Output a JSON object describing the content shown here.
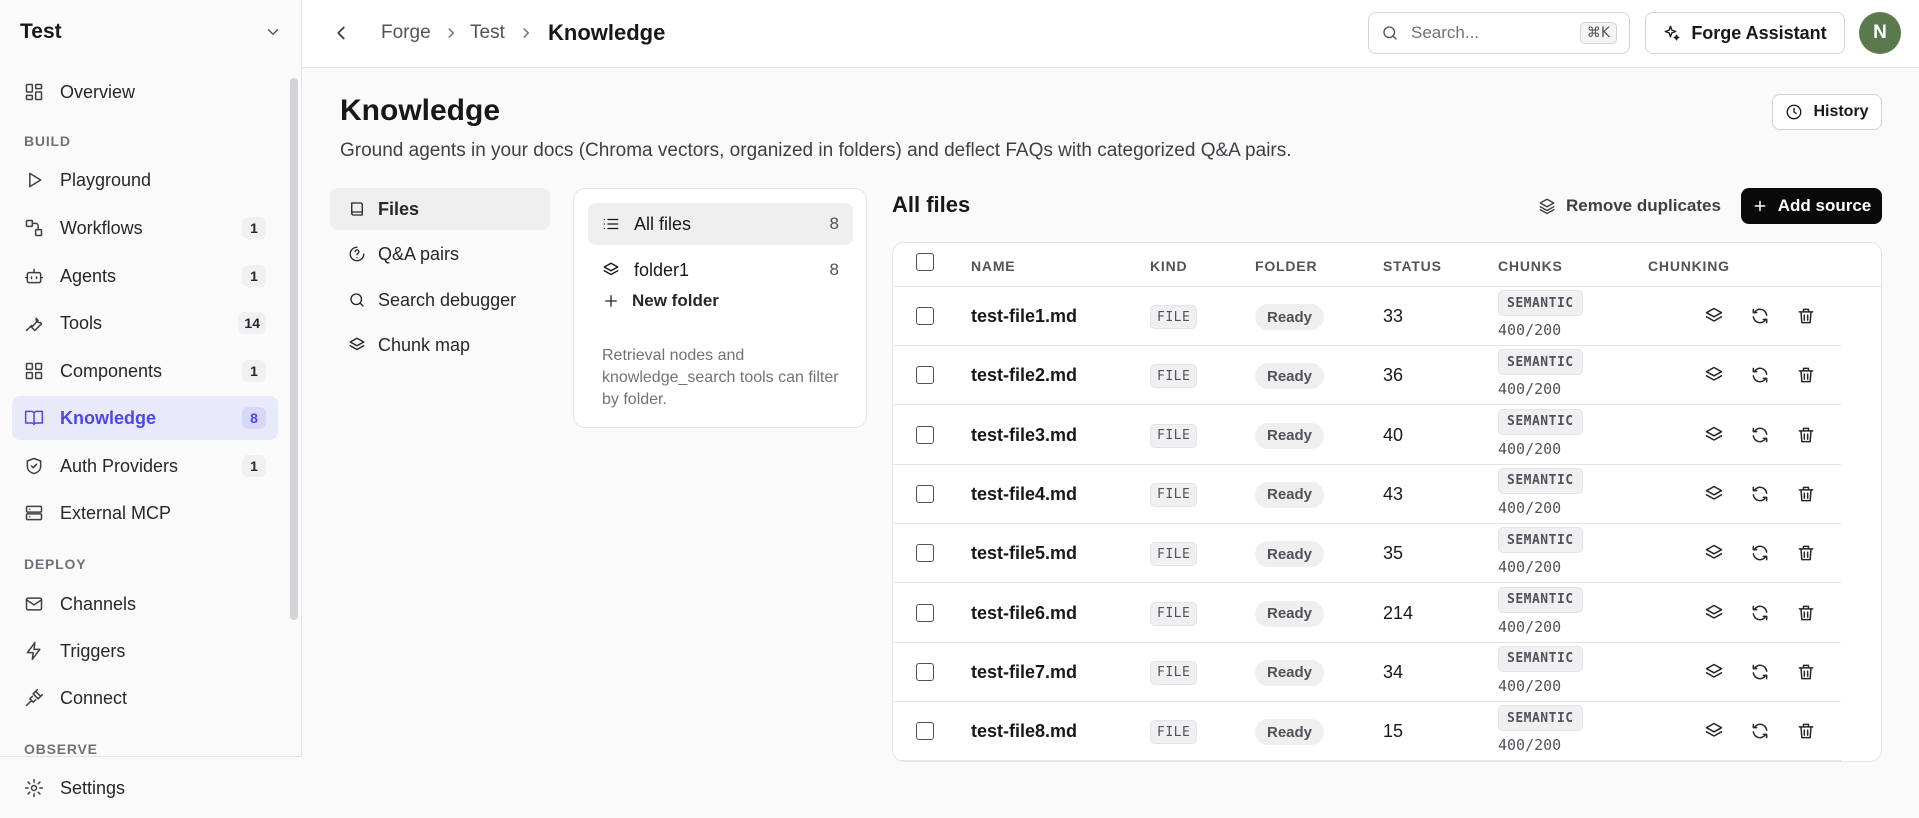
{
  "workspace": {
    "name": "Test"
  },
  "sidebar": {
    "items": [
      {
        "label": "Overview",
        "count": ""
      },
      {
        "label": "Playground",
        "count": ""
      },
      {
        "label": "Workflows",
        "count": "1"
      },
      {
        "label": "Agents",
        "count": "1"
      },
      {
        "label": "Tools",
        "count": "14"
      },
      {
        "label": "Components",
        "count": "1"
      },
      {
        "label": "Knowledge",
        "count": "8"
      },
      {
        "label": "Auth Providers",
        "count": "1"
      },
      {
        "label": "External MCP",
        "count": ""
      },
      {
        "label": "Channels",
        "count": ""
      },
      {
        "label": "Triggers",
        "count": ""
      },
      {
        "label": "Connect",
        "count": ""
      }
    ],
    "sections": {
      "build": "BUILD",
      "deploy": "DEPLOY",
      "observe": "OBSERVE"
    },
    "settings_label": "Settings"
  },
  "header": {
    "breadcrumb": [
      "Forge",
      "Test",
      "Knowledge"
    ],
    "search_placeholder": "Search...",
    "search_shortcut": "⌘K",
    "assistant_label": "Forge Assistant",
    "avatar_initial": "N"
  },
  "page": {
    "title": "Knowledge",
    "subtitle": "Ground agents in your docs (Chroma vectors, organized in folders) and deflect FAQs with categorized Q&A pairs.",
    "history_label": "History"
  },
  "subnav": [
    "Files",
    "Q&A pairs",
    "Search debugger",
    "Chunk map"
  ],
  "folders": {
    "items": [
      {
        "label": "All files",
        "count": "8"
      },
      {
        "label": "folder1",
        "count": "8"
      }
    ],
    "new_folder_label": "New folder",
    "note": "Retrieval nodes and knowledge_search tools can filter by folder."
  },
  "files": {
    "title": "All files",
    "remove_duplicates_label": "Remove duplicates",
    "add_source_label": "Add source",
    "columns": [
      "NAME",
      "KIND",
      "FOLDER",
      "STATUS",
      "CHUNKS",
      "CHUNKING"
    ],
    "rows": [
      {
        "name": "test-file1.md",
        "kind": "FILE",
        "status": "Ready",
        "chunks": "33",
        "strategy": "SEMANTIC",
        "size": "400/200"
      },
      {
        "name": "test-file2.md",
        "kind": "FILE",
        "status": "Ready",
        "chunks": "36",
        "strategy": "SEMANTIC",
        "size": "400/200"
      },
      {
        "name": "test-file3.md",
        "kind": "FILE",
        "status": "Ready",
        "chunks": "40",
        "strategy": "SEMANTIC",
        "size": "400/200"
      },
      {
        "name": "test-file4.md",
        "kind": "FILE",
        "status": "Ready",
        "chunks": "43",
        "strategy": "SEMANTIC",
        "size": "400/200"
      },
      {
        "name": "test-file5.md",
        "kind": "FILE",
        "status": "Ready",
        "chunks": "35",
        "strategy": "SEMANTIC",
        "size": "400/200"
      },
      {
        "name": "test-file6.md",
        "kind": "FILE",
        "status": "Ready",
        "chunks": "214",
        "strategy": "SEMANTIC",
        "size": "400/200"
      },
      {
        "name": "test-file7.md",
        "kind": "FILE",
        "status": "Ready",
        "chunks": "34",
        "strategy": "SEMANTIC",
        "size": "400/200"
      },
      {
        "name": "test-file8.md",
        "kind": "FILE",
        "status": "Ready",
        "chunks": "15",
        "strategy": "SEMANTIC",
        "size": "400/200"
      }
    ]
  },
  "colors": {
    "accent": "#4f46e5",
    "accent_bg": "#e8e9fb",
    "avatar": "#5a7a4e",
    "primary_button": "#0a0a0a"
  }
}
